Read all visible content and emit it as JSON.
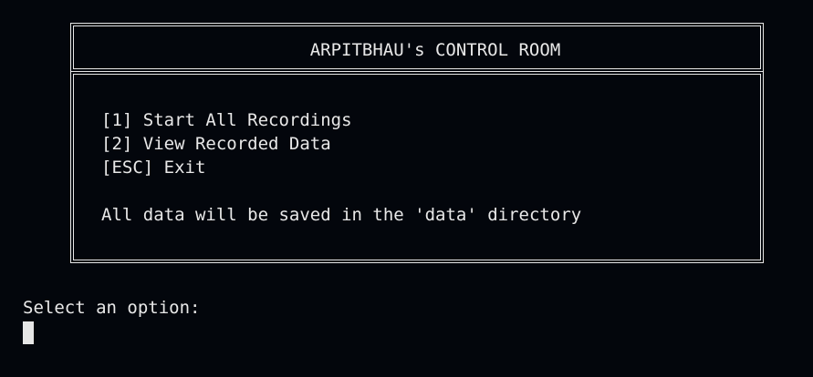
{
  "header": {
    "title": "ARPITBHAU's CONTROL ROOM"
  },
  "menu": {
    "items": [
      {
        "label": "[1] Start All Recordings"
      },
      {
        "label": "[2] View Recorded Data"
      },
      {
        "label": "[ESC] Exit"
      }
    ],
    "note": "All data will be saved in the 'data' directory"
  },
  "prompt": {
    "text": "Select an option:"
  },
  "colors": {
    "background": "#03060c",
    "foreground": "#e8e8e8"
  }
}
